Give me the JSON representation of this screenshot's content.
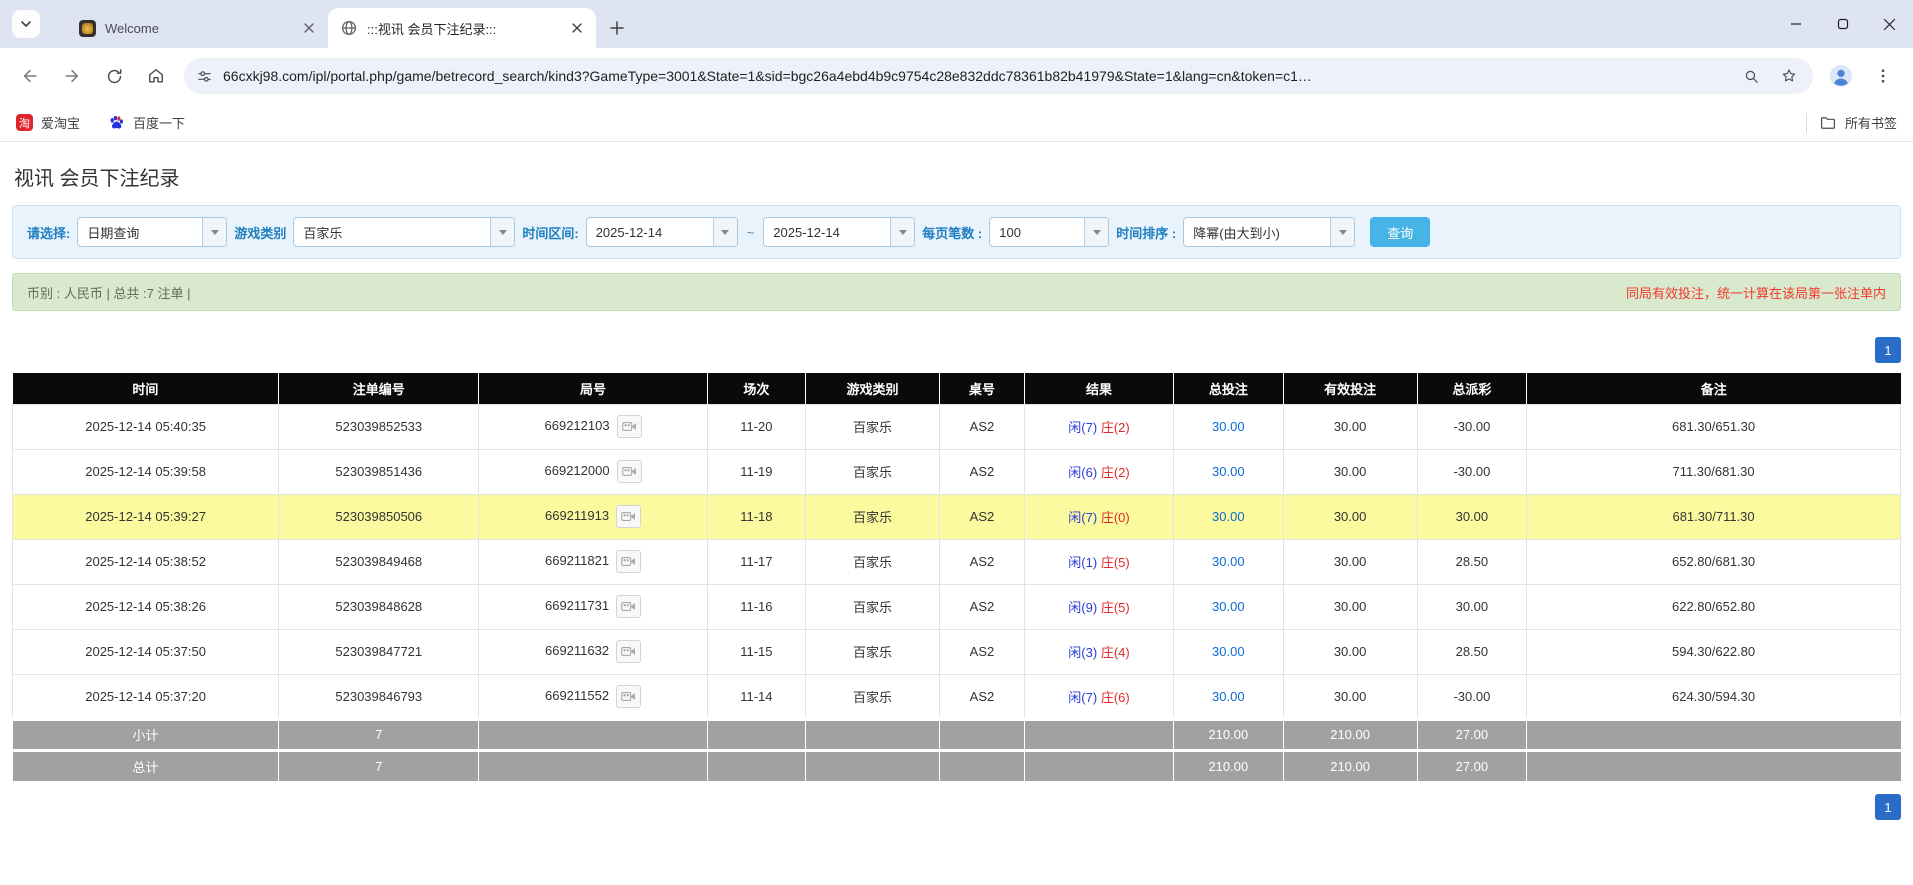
{
  "browser": {
    "tabs": [
      {
        "title": "Welcome"
      },
      {
        "title": ":::视讯 会员下注纪录:::"
      }
    ],
    "url": "66cxkj98.com/ipl/portal.php/game/betrecord_search/kind3?GameType=3001&State=1&sid=bgc26a4ebd4b9c9754c28e832ddc78361b82b41979&State=1&lang=cn&token=c1…",
    "bookmarks": [
      {
        "label": "爱淘宝"
      },
      {
        "label": "百度一下"
      }
    ],
    "all_bookmarks_label": "所有书签"
  },
  "page": {
    "title": "视讯 会员下注纪录",
    "filters": {
      "select_label": "请选择:",
      "select_value": "日期查询",
      "game_type_label": "游戏类别",
      "game_type_value": "百家乐",
      "date_range_label": "时间区间:",
      "date_from": "2025-12-14",
      "tilde": "~",
      "date_to": "2025-12-14",
      "page_size_label": "每页笔数 :",
      "page_size_value": "100",
      "sort_label": "时间排序 :",
      "sort_value": "降幂(由大到小)",
      "search_button": "查询"
    },
    "info_bar": {
      "left": "币别 : 人民币 | 总共 :7 注单 |",
      "right": "同局有效投注，统一计算在该局第一张注单内"
    },
    "pagination": "1",
    "table": {
      "headers": [
        "时间",
        "注单编号",
        "局号",
        "场次",
        "游戏类别",
        "桌号",
        "结果",
        "总投注",
        "有效投注",
        "总派彩",
        "备注"
      ],
      "rows": [
        {
          "time": "2025-12-14 05:40:35",
          "bet_id": "523039852533",
          "round_id": "669212103",
          "session": "11-20",
          "game": "百家乐",
          "table_no": "AS2",
          "result_player": "闲(7)",
          "result_banker": "庄(2)",
          "total_bet": "30.00",
          "valid_bet": "30.00",
          "payout": "-30.00",
          "remark": "681.30/651.30",
          "highlighted": false
        },
        {
          "time": "2025-12-14 05:39:58",
          "bet_id": "523039851436",
          "round_id": "669212000",
          "session": "11-19",
          "game": "百家乐",
          "table_no": "AS2",
          "result_player": "闲(6)",
          "result_banker": "庄(2)",
          "total_bet": "30.00",
          "valid_bet": "30.00",
          "payout": "-30.00",
          "remark": "711.30/681.30",
          "highlighted": false
        },
        {
          "time": "2025-12-14 05:39:27",
          "bet_id": "523039850506",
          "round_id": "669211913",
          "session": "11-18",
          "game": "百家乐",
          "table_no": "AS2",
          "result_player": "闲(7)",
          "result_banker": "庄(0)",
          "total_bet": "30.00",
          "valid_bet": "30.00",
          "payout": "30.00",
          "remark": "681.30/711.30",
          "highlighted": true
        },
        {
          "time": "2025-12-14 05:38:52",
          "bet_id": "523039849468",
          "round_id": "669211821",
          "session": "11-17",
          "game": "百家乐",
          "table_no": "AS2",
          "result_player": "闲(1)",
          "result_banker": "庄(5)",
          "total_bet": "30.00",
          "valid_bet": "30.00",
          "payout": "28.50",
          "remark": "652.80/681.30",
          "highlighted": false
        },
        {
          "time": "2025-12-14 05:38:26",
          "bet_id": "523039848628",
          "round_id": "669211731",
          "session": "11-16",
          "game": "百家乐",
          "table_no": "AS2",
          "result_player": "闲(9)",
          "result_banker": "庄(5)",
          "total_bet": "30.00",
          "valid_bet": "30.00",
          "payout": "30.00",
          "remark": "622.80/652.80",
          "highlighted": false
        },
        {
          "time": "2025-12-14 05:37:50",
          "bet_id": "523039847721",
          "round_id": "669211632",
          "session": "11-15",
          "game": "百家乐",
          "table_no": "AS2",
          "result_player": "闲(3)",
          "result_banker": "庄(4)",
          "total_bet": "30.00",
          "valid_bet": "30.00",
          "payout": "28.50",
          "remark": "594.30/622.80",
          "highlighted": false
        },
        {
          "time": "2025-12-14 05:37:20",
          "bet_id": "523039846793",
          "round_id": "669211552",
          "session": "11-14",
          "game": "百家乐",
          "table_no": "AS2",
          "result_player": "闲(7)",
          "result_banker": "庄(6)",
          "total_bet": "30.00",
          "valid_bet": "30.00",
          "payout": "-30.00",
          "remark": "624.30/594.30",
          "highlighted": false
        }
      ],
      "subtotal": {
        "label": "小计",
        "count": "7",
        "total_bet": "210.00",
        "valid_bet": "210.00",
        "payout": "27.00"
      },
      "total": {
        "label": "总计",
        "count": "7",
        "total_bet": "210.00",
        "valid_bet": "210.00",
        "payout": "27.00"
      }
    }
  },
  "colors": {
    "accent": "#46b5e5",
    "pager": "#2a6dc9",
    "highlight": "#fbfa9e",
    "link": "#0b6cd4",
    "negative": "#e60000",
    "player_blue": "#2a3cd6",
    "banker_red": "#e02a2a",
    "header_bg": "#0a0a0a",
    "footer_bg": "#a1a1a1",
    "filter_bg": "#e9f3fb",
    "info_bg": "#d9e9cd",
    "note_red": "#f2392c"
  }
}
